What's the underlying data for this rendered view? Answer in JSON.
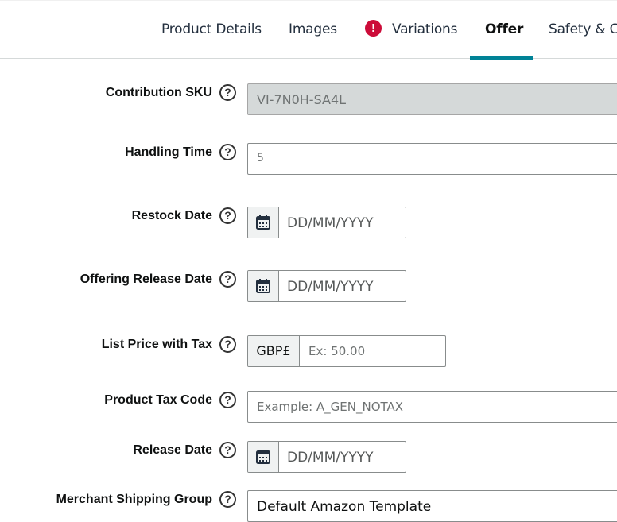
{
  "tabs": [
    {
      "label": "Product Details",
      "active": false,
      "alert": false
    },
    {
      "label": "Images",
      "active": false,
      "alert": false
    },
    {
      "label": "Variations",
      "active": false,
      "alert": true
    },
    {
      "label": "Offer",
      "active": true,
      "alert": false
    },
    {
      "label": "Safety & Co",
      "active": false,
      "alert": false
    }
  ],
  "alert_glyph": "!",
  "help_glyph": "?",
  "colors": {
    "accent": "#008296",
    "alert": "#cc0c39"
  },
  "form": {
    "contribution_sku": {
      "label": "Contribution SKU",
      "value": "VI-7N0H-SA4L",
      "disabled": true
    },
    "handling_time": {
      "label": "Handling Time",
      "value": "5"
    },
    "restock_date": {
      "label": "Restock Date",
      "placeholder": "DD/MM/YYYY",
      "icon": "calendar-icon"
    },
    "offering_release_date": {
      "label": "Offering Release Date",
      "placeholder": "DD/MM/YYYY",
      "icon": "calendar-icon"
    },
    "list_price_with_tax": {
      "label": "List Price with Tax",
      "currency": "GBP£",
      "placeholder": "Ex: 50.00"
    },
    "product_tax_code": {
      "label": "Product Tax Code",
      "placeholder": "Example: A_GEN_NOTAX"
    },
    "release_date": {
      "label": "Release Date",
      "placeholder": "DD/MM/YYYY",
      "icon": "calendar-icon"
    },
    "merchant_shipping_group": {
      "label": "Merchant Shipping Group",
      "value": "Default Amazon Template"
    }
  }
}
